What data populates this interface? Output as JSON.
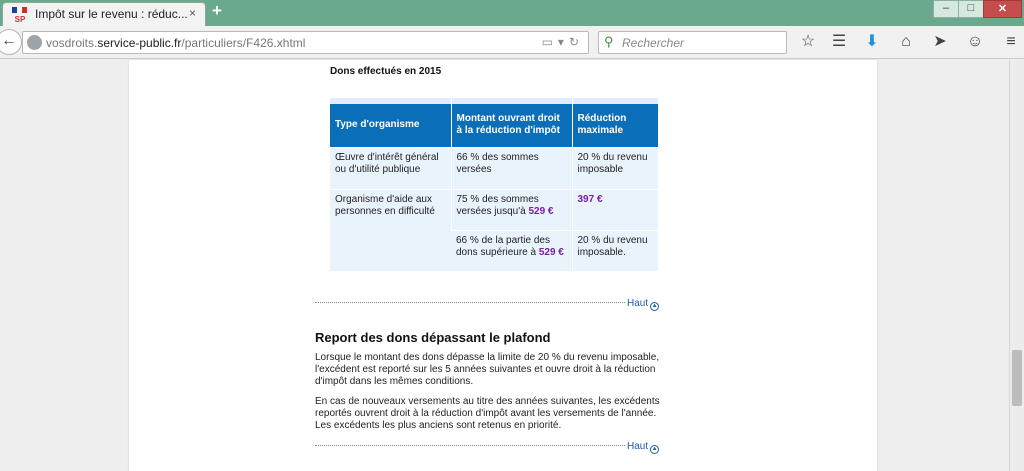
{
  "browser": {
    "tab_title": "Impôt sur le revenu : réduc...",
    "tab_close": "×",
    "new_tab": "+",
    "url_prefix": "vosdroits.",
    "url_host": "service-public.fr",
    "url_path": "/particuliers/F426.xhtml",
    "search_placeholder": "Rechercher",
    "favicon_text": "SP",
    "win_min": "–",
    "win_max": "□",
    "win_close": "✕"
  },
  "content": {
    "caption": "Dons effectués en 2015",
    "table": {
      "headers": [
        "Type d'organisme",
        "Montant ouvrant droit à la réduction d'impôt",
        "Réduction maximale"
      ],
      "row1": {
        "type": "Œuvre d'intérêt général ou d'utilité publique",
        "montant": "66 % des sommes versées",
        "reduction": "20 % du revenu imposable"
      },
      "row2": {
        "type": "Organisme d'aide aux personnes en difficulté",
        "montant_text": "75 % des sommes versées jusqu'à ",
        "montant_amount": "529 €",
        "reduction": "397 €"
      },
      "row3": {
        "montant_text": "66 % de la partie des dons supérieure à ",
        "montant_amount": "529 €",
        "reduction": "20 % du revenu imposable."
      }
    },
    "haut_label": "Haut",
    "haut_arrow": "▲",
    "report_title": "Report des dons dépassant le plafond",
    "para1": "Lorsque le montant des dons dépasse la limite de 20 % du revenu imposable, l'excédent est reporté sur les 5 années suivantes et ouvre droit à la réduction d'impôt dans les mêmes conditions.",
    "para2": "En cas de nouveaux versements au titre des années suivantes, les excédents reportés ouvrent droit à la réduction d'impôt avant les versements de l'année. Les excédents les plus anciens sont retenus en priorité."
  }
}
